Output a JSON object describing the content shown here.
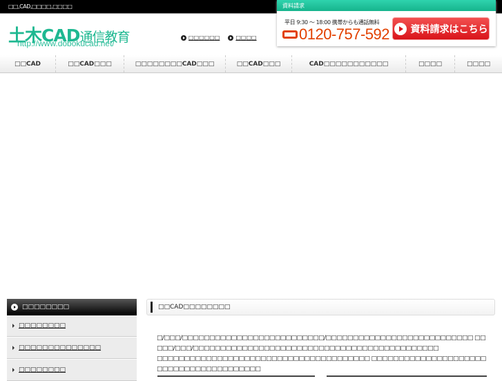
{
  "topbar": {
    "text": "□□,CAD,□□□□,□□□□"
  },
  "header": {
    "logo_main": "土木CAD",
    "logo_sub": "通信教育",
    "url": "http://www.dobokucad.net/",
    "links": [
      "□□□□□□",
      "□□□□"
    ]
  },
  "request": {
    "title": "資料請求",
    "hours": "平日 9:30 〜 18:00 携帯からも通話無料",
    "phone": "0120-757-592",
    "button": "資料請求はこちら"
  },
  "nav": {
    "items": [
      "□□CAD",
      "□□CAD□□□",
      "□□□□□□□□CAD□□□",
      "□□CAD□□□",
      "CAD□□□□□□□□□□□",
      "□□□□",
      "□□□□"
    ]
  },
  "sidebar": {
    "heading": "□□□□□□□□",
    "items": [
      "□□□□□□□□",
      "□□□□□□□□□□□□□□",
      "□□□□□□□□"
    ]
  },
  "main": {
    "heading": "□□CAD□□□□□□□□",
    "paragraph1": "□/□□□/□□□□□□□□□□□□□□□□□□□□□□□□□□/□□□□□□□□□□□□□□□□□□□□□□□□□□□ □□□□□/□□□/□□□□□□□□□□□□□□□□□□□□□□□□□□□□□□□□□□□□□□□□□□□□□",
    "paragraph2": "□□□□□□□□□□□□□□□□□□□□□□□□□□□□□□□□□□□□□□□ □□□□□□□□□□□□□□□□□□□□□□□□□□□□□□□□□□□□□□□□"
  }
}
